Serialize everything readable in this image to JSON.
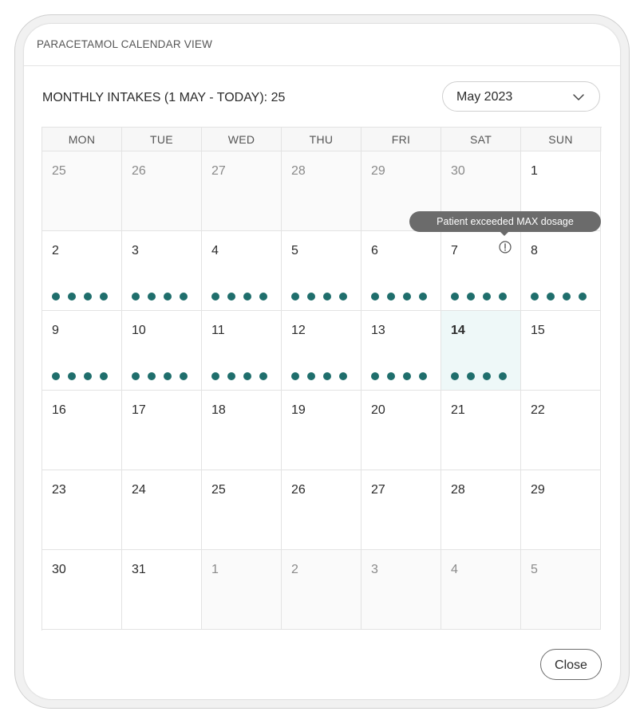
{
  "modal": {
    "title": "PARACETAMOL CALENDAR VIEW",
    "summary": "MONTHLY INTAKES (1 MAY - TODAY): 25",
    "month_select": {
      "value": "May 2023",
      "icon": "chevron-down-icon"
    },
    "close_label": "Close"
  },
  "tooltip": {
    "text": "Patient exceeded MAX dosage",
    "day": 7,
    "icon": "info-icon"
  },
  "colors": {
    "dot": "#1f6e6c",
    "today_bg": "#eef8f8",
    "tooltip_bg": "#6b6b6b"
  },
  "calendar": {
    "weekdays": [
      "MON",
      "TUE",
      "WED",
      "THU",
      "FRI",
      "SAT",
      "SUN"
    ],
    "weeks": [
      [
        {
          "day": "25",
          "muted": true,
          "dots": 0
        },
        {
          "day": "26",
          "muted": true,
          "dots": 0
        },
        {
          "day": "27",
          "muted": true,
          "dots": 0
        },
        {
          "day": "28",
          "muted": true,
          "dots": 0
        },
        {
          "day": "29",
          "muted": true,
          "dots": 0
        },
        {
          "day": "30",
          "muted": true,
          "dots": 0
        },
        {
          "day": "1",
          "dots": 0
        }
      ],
      [
        {
          "day": "2",
          "dots": 4
        },
        {
          "day": "3",
          "dots": 4
        },
        {
          "day": "4",
          "dots": 4
        },
        {
          "day": "5",
          "dots": 4
        },
        {
          "day": "6",
          "dots": 4
        },
        {
          "day": "7",
          "dots": 4,
          "warning": true
        },
        {
          "day": "8",
          "dots": 4
        }
      ],
      [
        {
          "day": "9",
          "dots": 4
        },
        {
          "day": "10",
          "dots": 4
        },
        {
          "day": "11",
          "dots": 4
        },
        {
          "day": "12",
          "dots": 4
        },
        {
          "day": "13",
          "dots": 4
        },
        {
          "day": "14",
          "dots": 4,
          "today": true
        },
        {
          "day": "15",
          "dots": 0
        }
      ],
      [
        {
          "day": "16",
          "dots": 0
        },
        {
          "day": "17",
          "dots": 0
        },
        {
          "day": "18",
          "dots": 0
        },
        {
          "day": "19",
          "dots": 0
        },
        {
          "day": "20",
          "dots": 0
        },
        {
          "day": "21",
          "dots": 0
        },
        {
          "day": "22",
          "dots": 0
        }
      ],
      [
        {
          "day": "23",
          "dots": 0
        },
        {
          "day": "24",
          "dots": 0
        },
        {
          "day": "25",
          "dots": 0
        },
        {
          "day": "26",
          "dots": 0
        },
        {
          "day": "27",
          "dots": 0
        },
        {
          "day": "28",
          "dots": 0
        },
        {
          "day": "29",
          "dots": 0
        }
      ],
      [
        {
          "day": "30",
          "dots": 0
        },
        {
          "day": "31",
          "dots": 0
        },
        {
          "day": "1",
          "muted": true,
          "dots": 0
        },
        {
          "day": "2",
          "muted": true,
          "dots": 0
        },
        {
          "day": "3",
          "muted": true,
          "dots": 0
        },
        {
          "day": "4",
          "muted": true,
          "dots": 0
        },
        {
          "day": "5",
          "muted": true,
          "dots": 0
        }
      ]
    ]
  }
}
